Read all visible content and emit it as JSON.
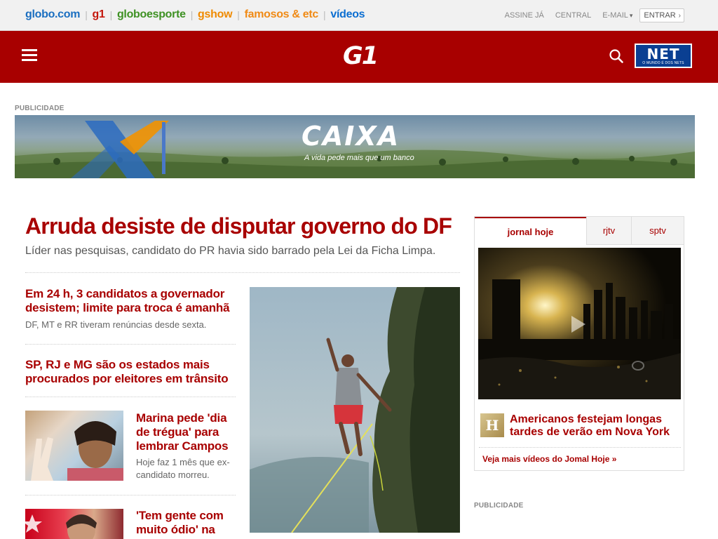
{
  "globo_bar": {
    "links": [
      {
        "label": "globo.com",
        "name": "globo-com-link",
        "cls": "gl-globo"
      },
      {
        "label": "g1",
        "name": "g1-link",
        "cls": "gl-g1"
      },
      {
        "label": "globoesporte",
        "name": "globoesporte-link",
        "cls": "gl-ge"
      },
      {
        "label": "gshow",
        "name": "gshow-link",
        "cls": "gl-gshow"
      },
      {
        "label": "famosos & etc",
        "name": "famosos-link",
        "cls": "gl-famosos"
      },
      {
        "label": "vídeos",
        "name": "videos-link",
        "cls": "gl-videos"
      }
    ],
    "assine": "ASSINE JÁ",
    "central": "CENTRAL",
    "email": "E-MAIL",
    "entrar": "ENTRAR"
  },
  "header": {
    "logo": "G1",
    "net_logo": "NET",
    "net_tagline": "O MUNDO É DOS NETS"
  },
  "ad": {
    "label": "PUBLICIDADE",
    "brand": "CAIXA",
    "slogan": "A vida pede mais que um banco"
  },
  "main": {
    "headline": "Arruda desiste de disputar governo do DF",
    "subheadline": "Líder nas pesquisas, candidato do PR havia sido barrado pela Lei da Ficha Limpa.",
    "stories": {
      "s1_title": "Em 24 h, 3 candidatos a governador desistem; limite para troca é amanhã",
      "s1_sub": "DF, MT e RR tiveram renúncias desde sexta.",
      "s2_title": "SP, RJ e MG são os estados mais procurados por eleitores em trânsito",
      "s3_title": "Marina pede 'dia de trégua' para lembrar Campos",
      "s3_sub": "Hoje faz 1 mês que ex-candidato morreu.",
      "s4_title": "'Tem gente com muito ódio' na"
    }
  },
  "video_widget": {
    "tabs": [
      "jornal hoje",
      "rjtv",
      "sptv"
    ],
    "active_tab": 0,
    "video_title": "Americanos festejam longas tardes de verão em Nova York",
    "more_link": "Veja mais vídeos do Jomal Hoje »",
    "icon_letter": "H"
  },
  "sidebar_ad": {
    "label": "PUBLICIDADE"
  },
  "colors": {
    "brand_red": "#a80000",
    "globo_bar_bg": "#f1f1f1",
    "net_blue": "#0a3f92"
  }
}
